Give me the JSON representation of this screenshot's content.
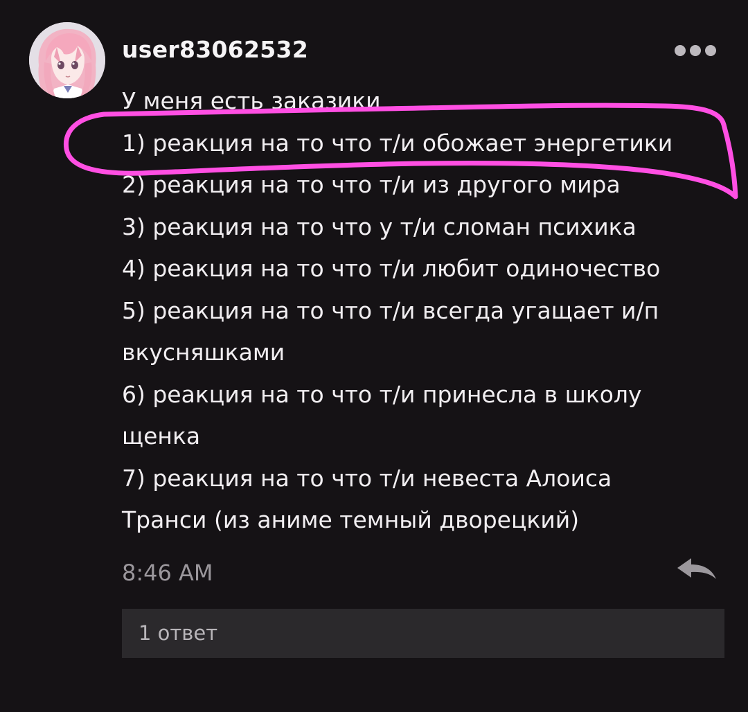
{
  "comment": {
    "username": "user83062532",
    "avatar_icon": "anime-avatar-icon",
    "more_icon": "more-options-icon",
    "lines": [
      "У меня есть заказики",
      "1) реакция на то что т/и обожает энергетики",
      "2) реакция на то что т/и из другого мира",
      "3) реакция на то что у т/и сломан психика",
      "4) реакция на то что т/и любит одиночество",
      "5) реакция на то что т/и всегда угащает и/п",
      "вкусняшками",
      "6) реакция на то что т/и принесла в школу",
      "щенка",
      "7) реакция на то что т/и невеста Алоиса",
      "Транси (из аниме темный дворецкий)"
    ],
    "time": "8:46 AM",
    "reply_icon": "reply-arrow-icon",
    "replies_label": "1 ответ"
  },
  "colors": {
    "background": "#151215",
    "text": "#f1eef1",
    "muted": "#9b979c",
    "replies_bg": "#2b292c",
    "highlight": "#ff4fe3"
  }
}
